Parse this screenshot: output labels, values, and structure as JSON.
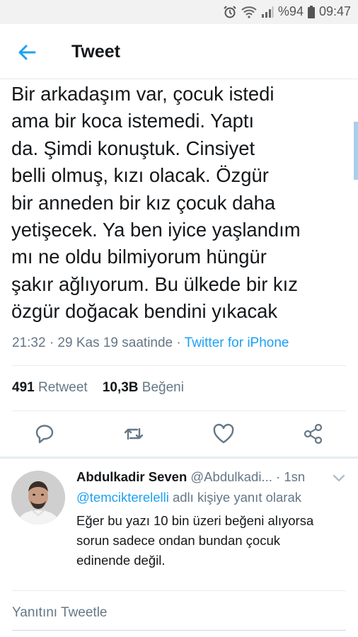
{
  "status_bar": {
    "battery": "%94",
    "time": "09:47",
    "icons": [
      "alarm-icon",
      "wifi-icon",
      "signal-icon",
      "battery-icon"
    ]
  },
  "header": {
    "title": "Tweet",
    "back_icon": "arrow-left-icon"
  },
  "tweet": {
    "lines": [
      "Bir arkadaşım var, çocuk istedi",
      "ama bir koca istemedi. Yaptı",
      "da. Şimdi konuştuk. Cinsiyet",
      "belli olmuş, kızı olacak. Özgür",
      "bir anneden bir kız çocuk daha",
      "yetişecek. Ya ben iyice yaşlandım",
      "mı ne oldu bilmiyorum hüngür",
      "şakır ağlıyorum. Bu ülkede bir kız",
      "özgür doğacak bendini yıkacak"
    ],
    "timestamp": "21:32 · 29 Kas 19 saatinde · ",
    "source": "Twitter for iPhone"
  },
  "stats": {
    "retweet_count": "491",
    "retweet_label": "Retweet",
    "like_count": "10,3B",
    "like_label": "Beğeni"
  },
  "actions": [
    "reply-icon",
    "retweet-icon",
    "like-icon",
    "share-icon"
  ],
  "reply": {
    "name": "Abdulkadir Seven",
    "handle": "@Abdulkadi...",
    "time": "· 1sn",
    "mention": "@temcikterelelli",
    "context_suffix": " adlı kişiye yanıt olarak",
    "lines": [
      "Eğer bu yazı 10 bin üzeri beğeni alıyorsa",
      "sorun sadece ondan bundan çocuk",
      "edinende değil."
    ]
  },
  "compose": {
    "placeholder": "Yanıtını Tweetle"
  },
  "colors": {
    "accent": "#1da1f2",
    "muted": "#657786",
    "text": "#14171a",
    "divider": "#e6ecf0"
  }
}
